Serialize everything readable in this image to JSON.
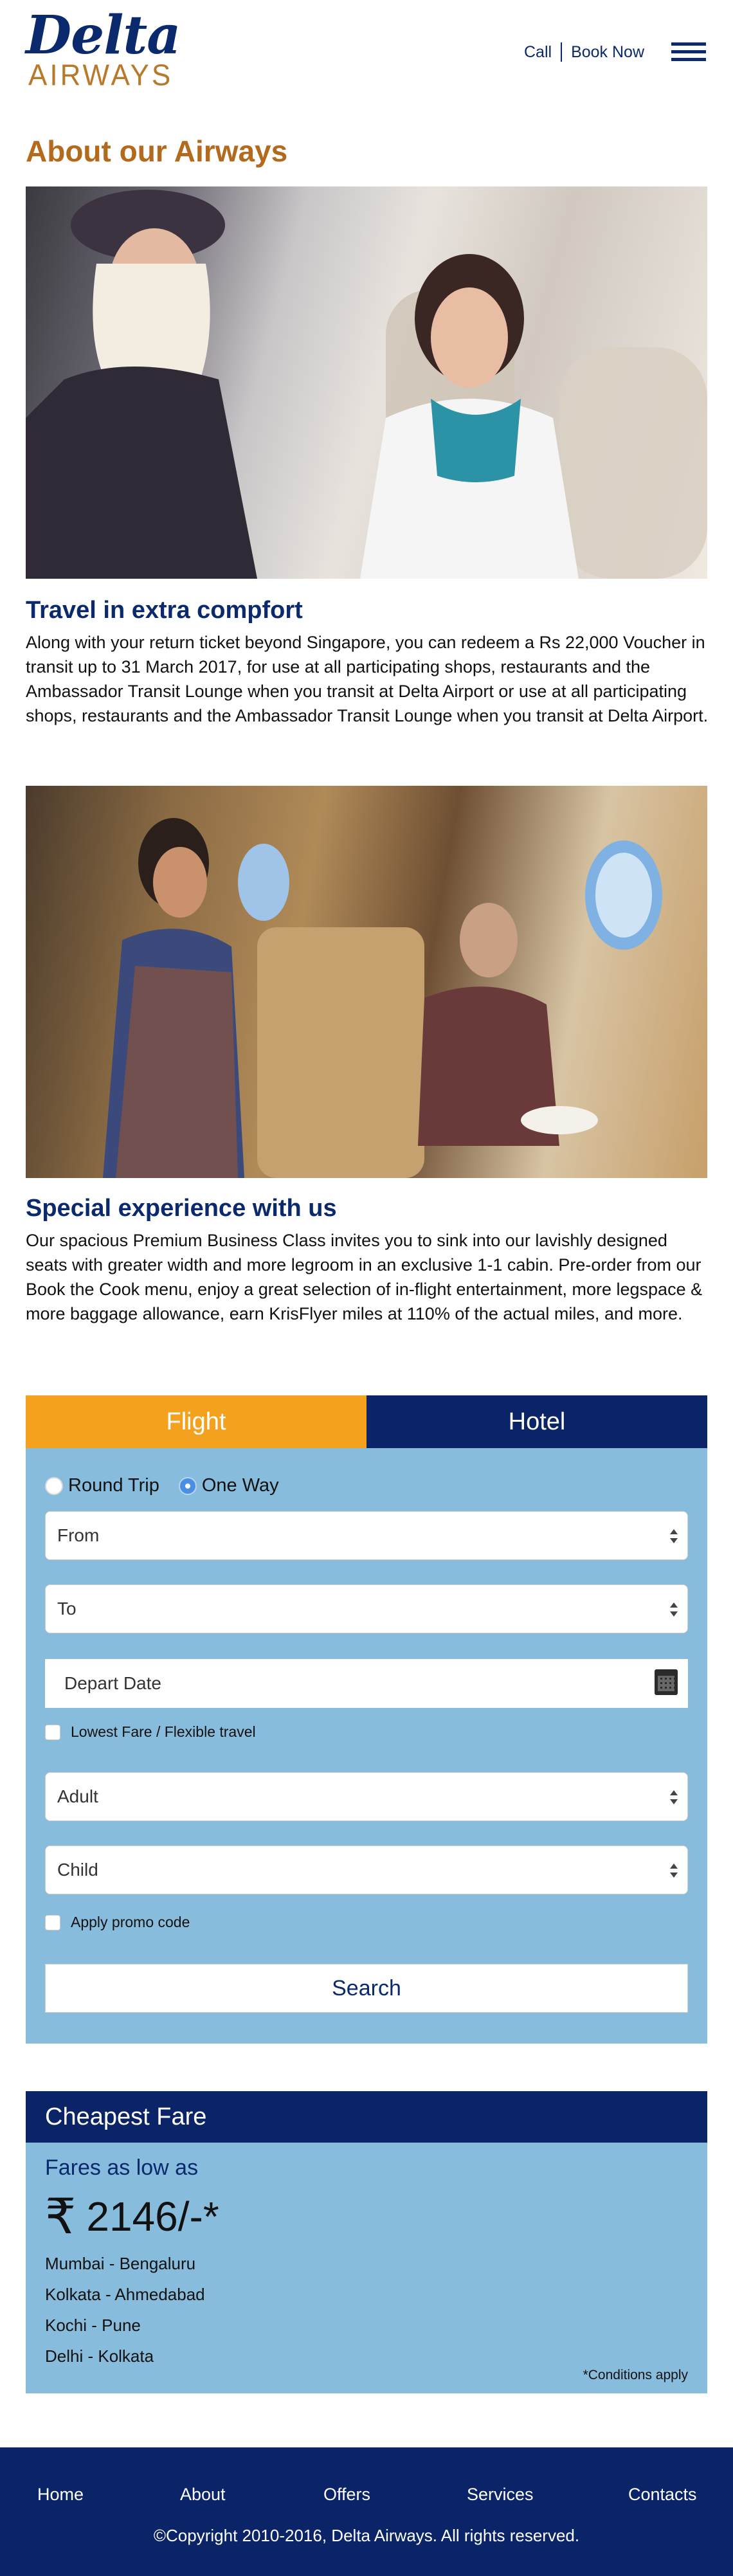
{
  "brand": {
    "name_top": "Delta",
    "name_bottom": "AIRWAYS"
  },
  "header": {
    "call_label": "Call",
    "book_label": "Book Now"
  },
  "about": {
    "title": "About our Airways",
    "blocks": [
      {
        "heading": "Travel in extra compfort",
        "text": "Along with your return ticket beyond Singapore, you can redeem a Rs 22,000 Voucher in transit up to 31 March 2017, for use at all participating shops, restaurants and the Ambassador Transit Lounge when you transit at Delta Airport or use at all participating shops, restaurants and the Ambassador Transit Lounge when you transit at Delta Airport."
      },
      {
        "heading": "Special experience with us",
        "text": "Our spacious Premium Business Class invites you to sink into our lavishly designed seats with greater width and more legroom in an exclusive 1-1 cabin. Pre-order from our Book the Cook menu, enjoy a great selection of in-flight entertainment, more legspace & more baggage allowance, earn KrisFlyer miles at 110% of the actual miles, and more."
      }
    ]
  },
  "booking": {
    "tabs": {
      "flight": "Flight",
      "hotel": "Hotel"
    },
    "trip": {
      "round": "Round Trip",
      "oneway": "One Way",
      "selected": "One Way"
    },
    "from": "From",
    "to": "To",
    "depart_placeholder": "Depart Date",
    "lowest_fare": "Lowest Fare / Flexible travel",
    "adult": "Adult",
    "child": "Child",
    "promo": "Apply promo code",
    "search": "Search"
  },
  "fare": {
    "heading": "Cheapest Fare",
    "sub": "Fares as low as",
    "currency_symbol": "₹",
    "price": "2146/-*",
    "routes": [
      "Mumbai - Bengaluru",
      "Kolkata - Ahmedabad",
      "Kochi - Pune",
      "Delhi - Kolkata"
    ],
    "conditions": "*Conditions apply"
  },
  "footer": {
    "nav": [
      "Home",
      "About",
      "Offers",
      "Services",
      "Contacts"
    ],
    "copyright": "©Copyright 2010-2016, Delta Airways. All rights reserved."
  },
  "colors": {
    "navy": "#0b2468",
    "orange": "#f4a21d",
    "title_brown": "#b36a1c",
    "panel_blue": "#87bcdc"
  }
}
